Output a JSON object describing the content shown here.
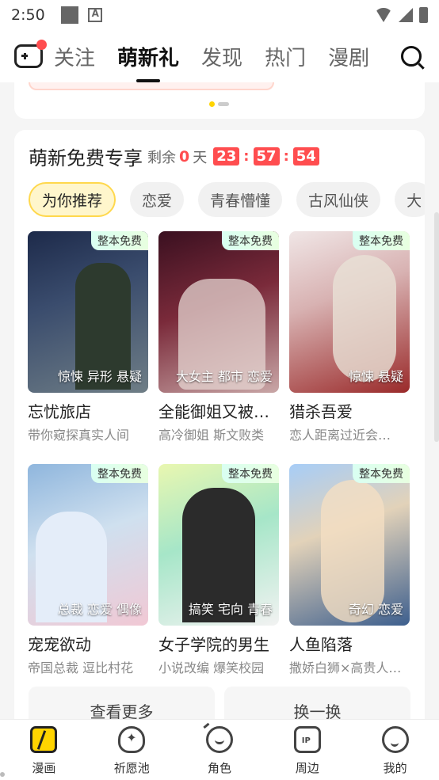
{
  "status": {
    "time": "2:50"
  },
  "topnav": {
    "tabs": [
      "关注",
      "萌新礼",
      "发现",
      "热门",
      "漫剧"
    ],
    "active_index": 1
  },
  "section": {
    "title": "萌新免费专享",
    "remaining_label": "剩余",
    "days": "0",
    "days_unit": "天",
    "hours": "23",
    "minutes": "57",
    "seconds": "54",
    "countdown_separator": ":"
  },
  "chips": [
    "为你推荐",
    "恋爱",
    "青春懵懂",
    "古风仙侠",
    "大"
  ],
  "badge_text": "整本免费",
  "books": [
    {
      "title": "忘忧旅店",
      "desc": "带你窥探真实人间",
      "tags": "惊悚 异形 悬疑"
    },
    {
      "title": "全能御姐又被…",
      "desc": "高冷御姐 斯文败类",
      "tags": "大女主 都市 恋爱"
    },
    {
      "title": "猎杀吾爱",
      "desc": "恋人距离过近会…",
      "tags": "惊悚 悬疑"
    },
    {
      "title": "宠宠欲动",
      "desc": "帝国总裁 逗比村花",
      "tags": "总裁 恋爱 偶像"
    },
    {
      "title": "女子学院的男生",
      "desc": "小说改编 爆笑校园",
      "tags": "搞笑 宅向 青春"
    },
    {
      "title": "人鱼陷落",
      "desc": "撒娇白狮×高贵人…",
      "tags": "奇幻 恋爱"
    }
  ],
  "buttons": {
    "more": "查看更多",
    "refresh": "换一换"
  },
  "bottomnav": [
    "漫画",
    "祈愿池",
    "角色",
    "周边",
    "我的"
  ],
  "colors": {
    "accent_red": "#ff4d4f",
    "accent_yellow": "#ffd400"
  }
}
